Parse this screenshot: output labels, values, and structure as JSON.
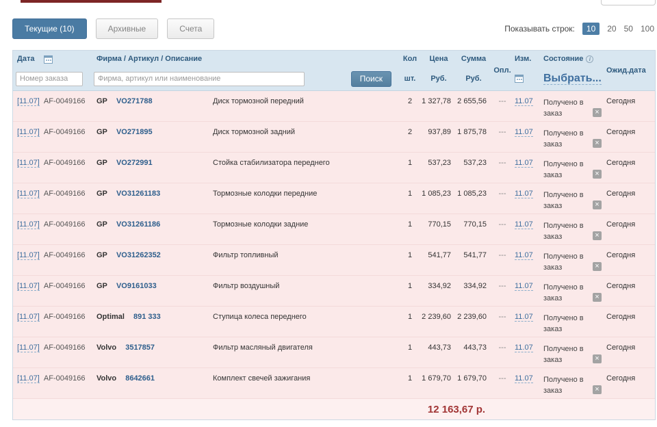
{
  "glyphs": {
    "cancel": "×",
    "info": "i"
  },
  "rows_control": {
    "label": "Показывать строк:",
    "options": [
      "10",
      "20",
      "50",
      "100"
    ],
    "selected": "10"
  },
  "tabs": [
    {
      "label": "Текущие (10)",
      "active": true
    },
    {
      "label": "Архивные",
      "active": false
    },
    {
      "label": "Счета",
      "active": false
    }
  ],
  "table": {
    "columns": {
      "date": "Дата",
      "firm": "Фирма / Артикул / Описание",
      "qty": "Кол",
      "qty_unit": "шт.",
      "price": "Цена",
      "price_unit": "Руб.",
      "sum": "Сумма",
      "sum_unit": "Руб.",
      "paid": "Опл.",
      "changed": "Изм.",
      "status": "Состояние",
      "status_select": "Выбрать...",
      "expected": "Ожид.дата"
    },
    "filters": {
      "order_number_placeholder": "Номер заказа",
      "firm_placeholder": "Фирма, артикул или наименование",
      "search_button": "Поиск"
    },
    "rows": [
      {
        "date_link": "[11.07]",
        "order_number": "AF-0049166",
        "brand": "GP",
        "article": "VO271788",
        "description": "Диск тормозной передний",
        "qty": "2",
        "price": "1 327,78",
        "sum": "2 655,56",
        "paid": "---",
        "changed": "11.07",
        "status": "Получено в заказ",
        "expected": "Сегодня",
        "cancellable": true
      },
      {
        "date_link": "[11.07]",
        "order_number": "AF-0049166",
        "brand": "GP",
        "article": "VO271895",
        "description": "Диск тормозной задний",
        "qty": "2",
        "price": "937,89",
        "sum": "1 875,78",
        "paid": "---",
        "changed": "11.07",
        "status": "Получено в заказ",
        "expected": "Сегодня",
        "cancellable": true
      },
      {
        "date_link": "[11.07]",
        "order_number": "AF-0049166",
        "brand": "GP",
        "article": "VO272991",
        "description": "Стойка стабилизатора переднего",
        "qty": "1",
        "price": "537,23",
        "sum": "537,23",
        "paid": "---",
        "changed": "11.07",
        "status": "Получено в заказ",
        "expected": "Сегодня",
        "cancellable": true
      },
      {
        "date_link": "[11.07]",
        "order_number": "AF-0049166",
        "brand": "GP",
        "article": "VO31261183",
        "description": "Тормозные колодки передние",
        "qty": "1",
        "price": "1 085,23",
        "sum": "1 085,23",
        "paid": "---",
        "changed": "11.07",
        "status": "Получено в заказ",
        "expected": "Сегодня",
        "cancellable": true
      },
      {
        "date_link": "[11.07]",
        "order_number": "AF-0049166",
        "brand": "GP",
        "article": "VO31261186",
        "description": "Тормозные колодки задние",
        "qty": "1",
        "price": "770,15",
        "sum": "770,15",
        "paid": "---",
        "changed": "11.07",
        "status": "Получено в заказ",
        "expected": "Сегодня",
        "cancellable": true
      },
      {
        "date_link": "[11.07]",
        "order_number": "AF-0049166",
        "brand": "GP",
        "article": "VO31262352",
        "description": "Фильтр топливный",
        "qty": "1",
        "price": "541,77",
        "sum": "541,77",
        "paid": "---",
        "changed": "11.07",
        "status": "Получено в заказ",
        "expected": "Сегодня",
        "cancellable": true
      },
      {
        "date_link": "[11.07]",
        "order_number": "AF-0049166",
        "brand": "GP",
        "article": "VO9161033",
        "description": "Фильтр воздушный",
        "qty": "1",
        "price": "334,92",
        "sum": "334,92",
        "paid": "---",
        "changed": "11.07",
        "status": "Получено в заказ",
        "expected": "Сегодня",
        "cancellable": true
      },
      {
        "date_link": "[11.07]",
        "order_number": "AF-0049166",
        "brand": "Optimal",
        "article": "891 333",
        "description": "Ступица колеса переднего",
        "qty": "1",
        "price": "2 239,60",
        "sum": "2 239,60",
        "paid": "---",
        "changed": "11.07",
        "status": "Получено в заказ",
        "expected": "Сегодня",
        "cancellable": false
      },
      {
        "date_link": "[11.07]",
        "order_number": "AF-0049166",
        "brand": "Volvo",
        "article": "3517857",
        "description": "Фильтр масляный двигателя",
        "qty": "1",
        "price": "443,73",
        "sum": "443,73",
        "paid": "---",
        "changed": "11.07",
        "status": "Получено в заказ",
        "expected": "Сегодня",
        "cancellable": true
      },
      {
        "date_link": "[11.07]",
        "order_number": "AF-0049166",
        "brand": "Volvo",
        "article": "8642661",
        "description": "Комплект свечей зажигания",
        "qty": "1",
        "price": "1 679,70",
        "sum": "1 679,70",
        "paid": "---",
        "changed": "11.07",
        "status": "Получено в заказ",
        "expected": "Сегодня",
        "cancellable": true
      }
    ],
    "total": "12 163,67 р."
  },
  "colors": {
    "accent_blue": "#4a7ba3",
    "header_blue": "#d8e6f0",
    "row_pink": "#fbe9e9",
    "total_red": "#a13535"
  }
}
